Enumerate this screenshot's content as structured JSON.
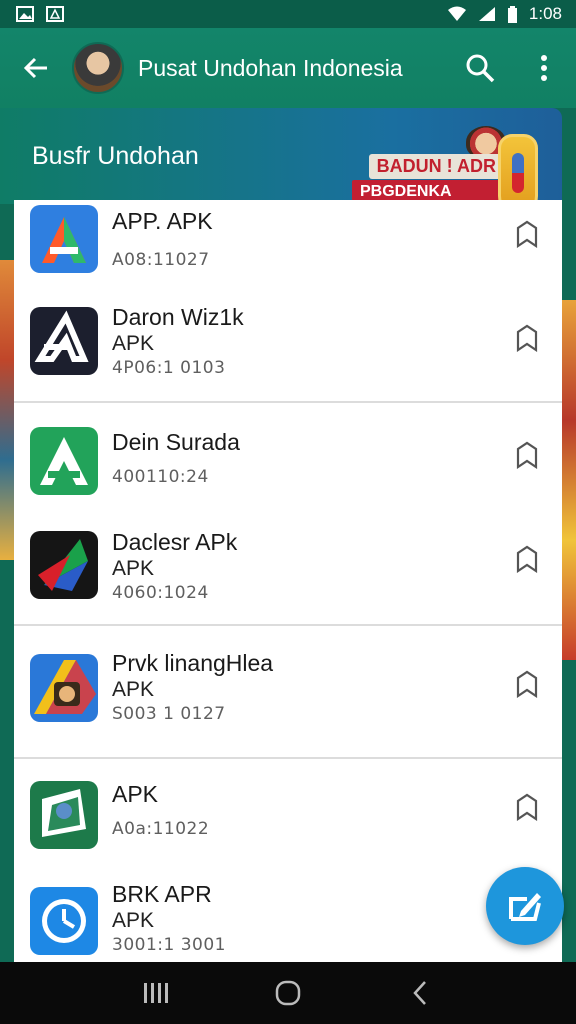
{
  "status_bar": {
    "time": "1:08",
    "icons": [
      "image-icon",
      "notification-icon",
      "wifi-icon",
      "signal-icon",
      "battery-icon"
    ]
  },
  "app_bar": {
    "title": "Pusat Undohan Indonesia",
    "icons": [
      "back-arrow-icon",
      "search-icon",
      "more-vert-icon"
    ]
  },
  "header": {
    "title": "Busfr Undohan",
    "banner_line1": "BADUN ! ADR",
    "banner_line2": "PBGDENKA OSOAN"
  },
  "list": {
    "groups": [
      {
        "items": [
          {
            "name": "APP. APK",
            "type": "",
            "code": "A08:11027",
            "icon": "app-a-blue-icon"
          },
          {
            "name": "Daron Wiz1k",
            "type": "APK",
            "code": "4P06:1 0103",
            "icon": "app-a-black-icon"
          }
        ]
      },
      {
        "items": [
          {
            "name": "Dein Surada",
            "type": "",
            "code": "400110:24",
            "icon": "app-a-green-icon"
          },
          {
            "name": "Daclesr APk",
            "type": "APK",
            "code": "4060:1024",
            "icon": "app-play-dark-icon"
          }
        ]
      },
      {
        "items": [
          {
            "name": "Prvk linangHlea",
            "type": "APK",
            "code": "S003 1 0127",
            "icon": "app-drive-icon"
          }
        ]
      },
      {
        "items": [
          {
            "name": "APK",
            "type": "",
            "code": "A0a:11022",
            "icon": "app-map-icon"
          },
          {
            "name": "BRK APR",
            "type": "APK",
            "code": "3001:1 3001",
            "icon": "app-clock-icon"
          }
        ]
      }
    ]
  },
  "fab": {
    "icon": "edit-icon"
  },
  "nav_bar": {
    "icons": [
      "recents-icon",
      "home-icon",
      "back-icon"
    ]
  },
  "colors": {
    "primary": "#118063",
    "status": "#0b5d49",
    "fab": "#1e96dc",
    "banner_red": "#c21f32"
  }
}
